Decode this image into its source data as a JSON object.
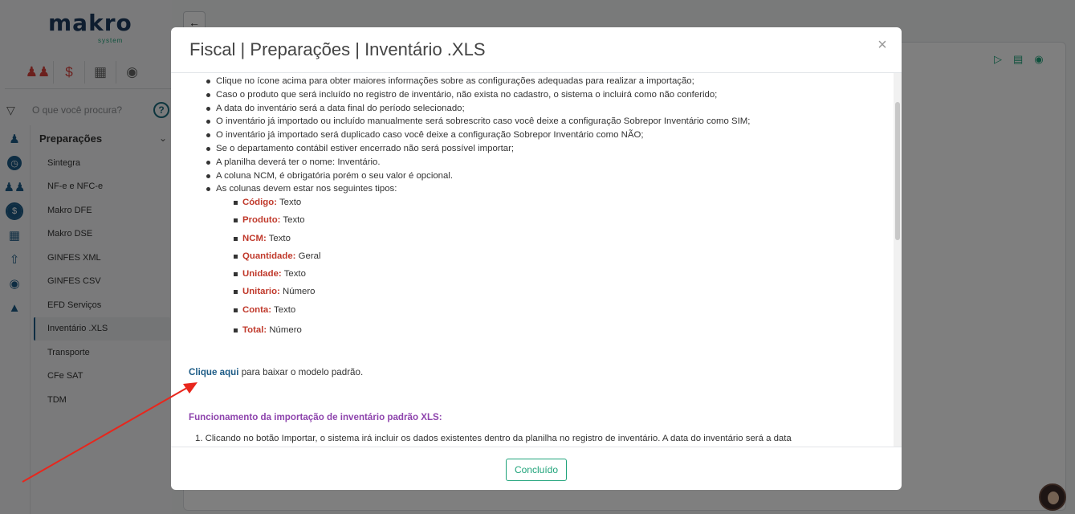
{
  "app": {
    "logo_text": "makro",
    "logo_sub": "system",
    "search_placeholder": "O que você procura?",
    "help_label": "?"
  },
  "sidebar": {
    "top_icons": [
      "users-icon",
      "dollar-icon",
      "grid-icon",
      "moneybag-icon"
    ],
    "rail_icons": [
      "user-gear-icon",
      "clock-icon",
      "people-icon",
      "dollar-circle-icon",
      "apps-icon",
      "upload-person-icon",
      "moneybag-icon",
      "graduation-cap-icon"
    ],
    "section_title": "Preparações",
    "items": [
      {
        "label": "Sintegra"
      },
      {
        "label": "NF-e e NFC-e"
      },
      {
        "label": "Makro DFE"
      },
      {
        "label": "Makro DSE"
      },
      {
        "label": "GINFES XML"
      },
      {
        "label": "GINFES CSV"
      },
      {
        "label": "EFD Serviços"
      },
      {
        "label": "Inventário .XLS"
      },
      {
        "label": "Transporte"
      },
      {
        "label": "CFe SAT"
      },
      {
        "label": "TDM"
      }
    ],
    "active_item": "Inventário .XLS"
  },
  "modal": {
    "title": "Fiscal | Preparações | Inventário .XLS",
    "close_label": "×",
    "bullets": [
      "Clique no ícone acima para obter maiores informações sobre as configurações adequadas para realizar a importação;",
      "Caso o produto que será incluído no registro de inventário, não exista no cadastro, o sistema o incluirá como não conferido;",
      "A data do inventário será a data final do período selecionado;",
      "O inventário já importado ou incluído manualmente será sobrescrito caso você deixe a configuração Sobrepor Inventário como SIM;",
      "O inventário já importado será duplicado caso você deixe a configuração Sobrepor Inventário como NÃO;",
      "Se o departamento contábil estiver encerrado não será possível importar;",
      "A planilha deverá ter o nome: Inventário.",
      "A coluna NCM, é obrigatória porém o seu valor é opcional.",
      "As colunas devem estar nos seguintes tipos:"
    ],
    "column_types": [
      {
        "name": "Código:",
        "type": "Texto"
      },
      {
        "name": "Produto:",
        "type": "Texto"
      },
      {
        "name": "NCM:",
        "type": "Texto"
      },
      {
        "name": "Quantidade:",
        "type": "Geral"
      },
      {
        "name": "Unidade:",
        "type": "Texto"
      },
      {
        "name": "Unitario:",
        "type": "Número"
      },
      {
        "name": "Conta:",
        "type": "Texto"
      },
      {
        "name": "Total:",
        "type": "Número"
      }
    ],
    "download_link": "Clique aqui",
    "download_text": "para baixar o modelo padrão.",
    "section_title": "Funcionamento da importação de inventário padrão XLS:",
    "ordered_item_1": "1. Clicando no botão Importar, o sistema irá incluir os dados existentes dentro da planilha no registro de inventário. A data do inventário será a data",
    "done_button": "Concluído"
  },
  "colors": {
    "accent_green": "#1fa37a",
    "link_blue": "#1c5b86",
    "key_red": "#c0392b",
    "section_purple": "#8e44ad",
    "arrow_red": "#e8261c"
  }
}
